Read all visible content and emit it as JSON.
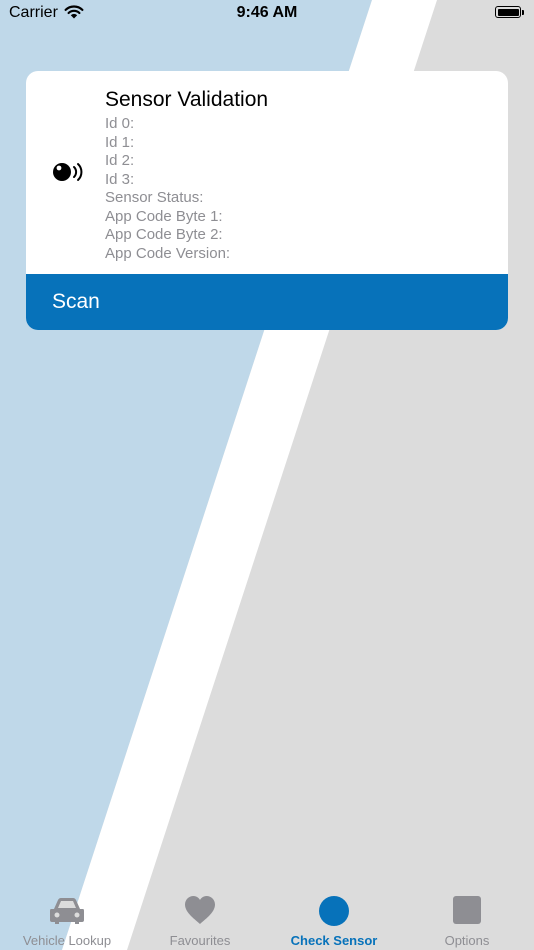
{
  "status_bar": {
    "carrier": "Carrier",
    "time": "9:46 AM"
  },
  "card": {
    "title": "Sensor Validation",
    "fields": [
      "Id 0:",
      "Id 1:",
      "Id 2:",
      "Id 3:",
      "Sensor Status:",
      "App Code Byte 1:",
      "App Code Byte 2:",
      "App Code Version:"
    ],
    "icon": "sensor-signal-icon",
    "scan_label": "Scan"
  },
  "tab_bar": {
    "active_index": 2,
    "tabs": [
      {
        "label": "Vehicle Lookup",
        "icon": "car-icon"
      },
      {
        "label": "Favourites",
        "icon": "heart-icon"
      },
      {
        "label": "Check Sensor",
        "icon": "circle-icon"
      },
      {
        "label": "Options",
        "icon": "square-icon"
      }
    ]
  },
  "colors": {
    "accent": "#0772ba",
    "background_blue": "#bfd8e9",
    "background_gray": "#dcdcdc",
    "inactive": "#8e8e93"
  }
}
